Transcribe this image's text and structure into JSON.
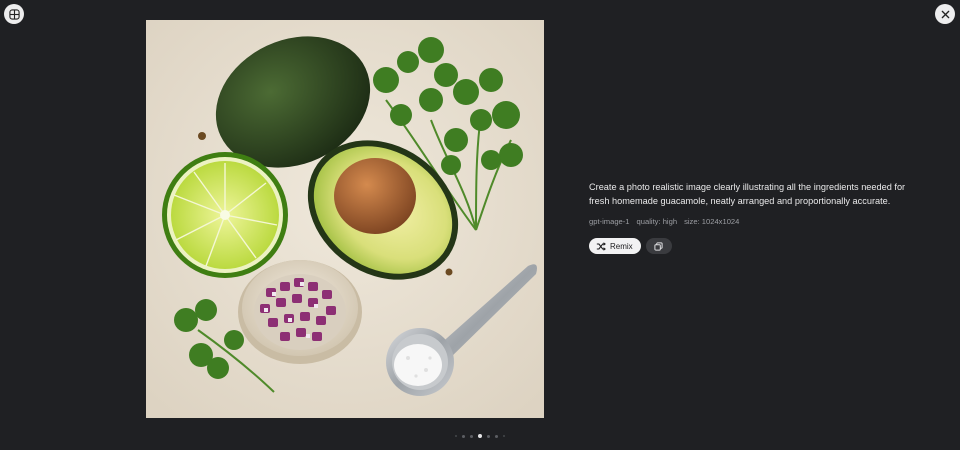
{
  "toolbar": {
    "gallery_icon": "grid-icon",
    "close_icon": "close-icon"
  },
  "prompt": {
    "text": "Create a photo realistic image clearly illustrating all the ingredients needed for fresh homemade guacamole, neatly arranged and proportionally accurate."
  },
  "meta": {
    "model": "gpt-image-1",
    "quality": "quality: high",
    "size": "size: 1024x1024"
  },
  "actions": {
    "remix_label": "Remix",
    "remix_icon": "shuffle-icon",
    "copy_icon": "copy-icon"
  },
  "image": {
    "alt": "Guacamole ingredients: avocados, lime, cilantro, diced red onion, salt",
    "background_color": "#e8e0d2"
  },
  "pager": {
    "total": 7,
    "active_index": 3
  },
  "colors": {
    "background": "#1f2023",
    "button_light": "#f2f2f3",
    "button_dark": "#3a3b3f"
  }
}
